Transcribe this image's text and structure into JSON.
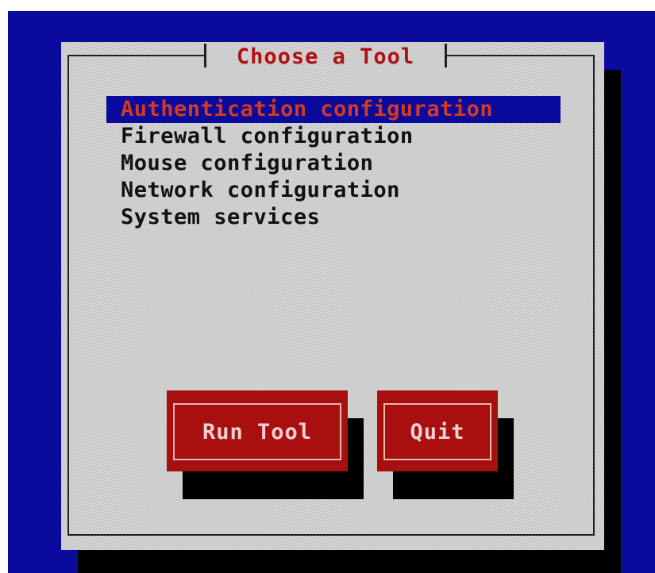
{
  "dialog": {
    "title": "Choose a Tool"
  },
  "menu": {
    "items": [
      {
        "label": "Authentication configuration",
        "selected": true
      },
      {
        "label": "Firewall configuration",
        "selected": false
      },
      {
        "label": "Mouse configuration",
        "selected": false
      },
      {
        "label": "Network configuration",
        "selected": false
      },
      {
        "label": "System services",
        "selected": false
      }
    ]
  },
  "buttons": {
    "run_tool_label": "Run Tool",
    "quit_label": "Quit"
  },
  "colors": {
    "screen_background": "#0a0a9c",
    "dialog_background": "#c6c6c6",
    "selection_background": "#0a0a9c",
    "selection_text": "#d23a22",
    "title_text": "#b01010",
    "button_background": "#a80f0f",
    "button_text": "#f0d0d0",
    "shadow": "#000000"
  }
}
